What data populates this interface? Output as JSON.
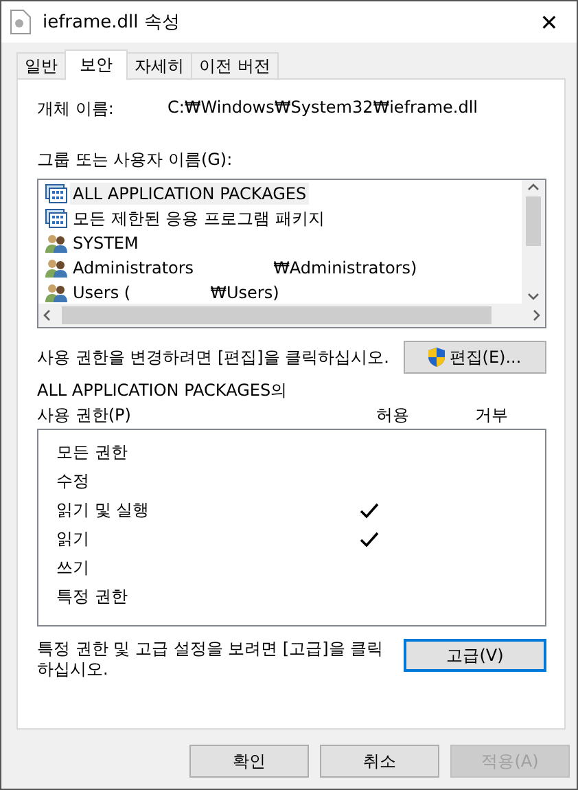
{
  "window": {
    "title": "ieframe.dll 속성",
    "close": "✕"
  },
  "tabs": [
    {
      "label": "일반",
      "selected": false
    },
    {
      "label": "보안",
      "selected": true
    },
    {
      "label": "자세히",
      "selected": false
    },
    {
      "label": "이전 버전",
      "selected": false
    }
  ],
  "object_name": {
    "label": "개체 이름:",
    "value": "C:₩Windows₩System32₩ieframe.dll"
  },
  "principals": {
    "label": "그룹 또는 사용자 이름(G):",
    "items": [
      {
        "kind": "package",
        "name": "ALL APPLICATION PACKAGES",
        "selected": true
      },
      {
        "kind": "package",
        "name": "모든 제한된 응용 프로그램 패키지",
        "selected": false
      },
      {
        "kind": "group",
        "name": "SYSTEM",
        "selected": false
      },
      {
        "kind": "group",
        "name": "Administrators",
        "tail": "₩Administrators)",
        "selected": false
      },
      {
        "kind": "group",
        "name": "Users (",
        "tail": "₩Users)",
        "selected": false
      }
    ]
  },
  "edit_hint": "사용 권한을 변경하려면 [편집]을 클릭하십시오.",
  "edit_button": "편집(E)...",
  "permissions": {
    "title": "ALL APPLICATION PACKAGES의",
    "label": "사용 권한(P)",
    "allow_header": "허용",
    "deny_header": "거부",
    "rows": [
      {
        "name": "모든 권한",
        "allow": false,
        "deny": false
      },
      {
        "name": "수정",
        "allow": false,
        "deny": false
      },
      {
        "name": "읽기 및 실행",
        "allow": true,
        "deny": false
      },
      {
        "name": "읽기",
        "allow": true,
        "deny": false
      },
      {
        "name": "쓰기",
        "allow": false,
        "deny": false
      },
      {
        "name": "특정 권한",
        "allow": false,
        "deny": false
      }
    ]
  },
  "advanced_hint": "특정 권한 및 고급 설정을 보려면 [고급]을 클릭하십시오.",
  "advanced_button": {
    "label": "고급(V)",
    "focused": true
  },
  "buttons": [
    {
      "label": "확인",
      "disabled": false
    },
    {
      "label": "취소",
      "disabled": false
    },
    {
      "label": "적용(A)",
      "disabled": true
    }
  ]
}
